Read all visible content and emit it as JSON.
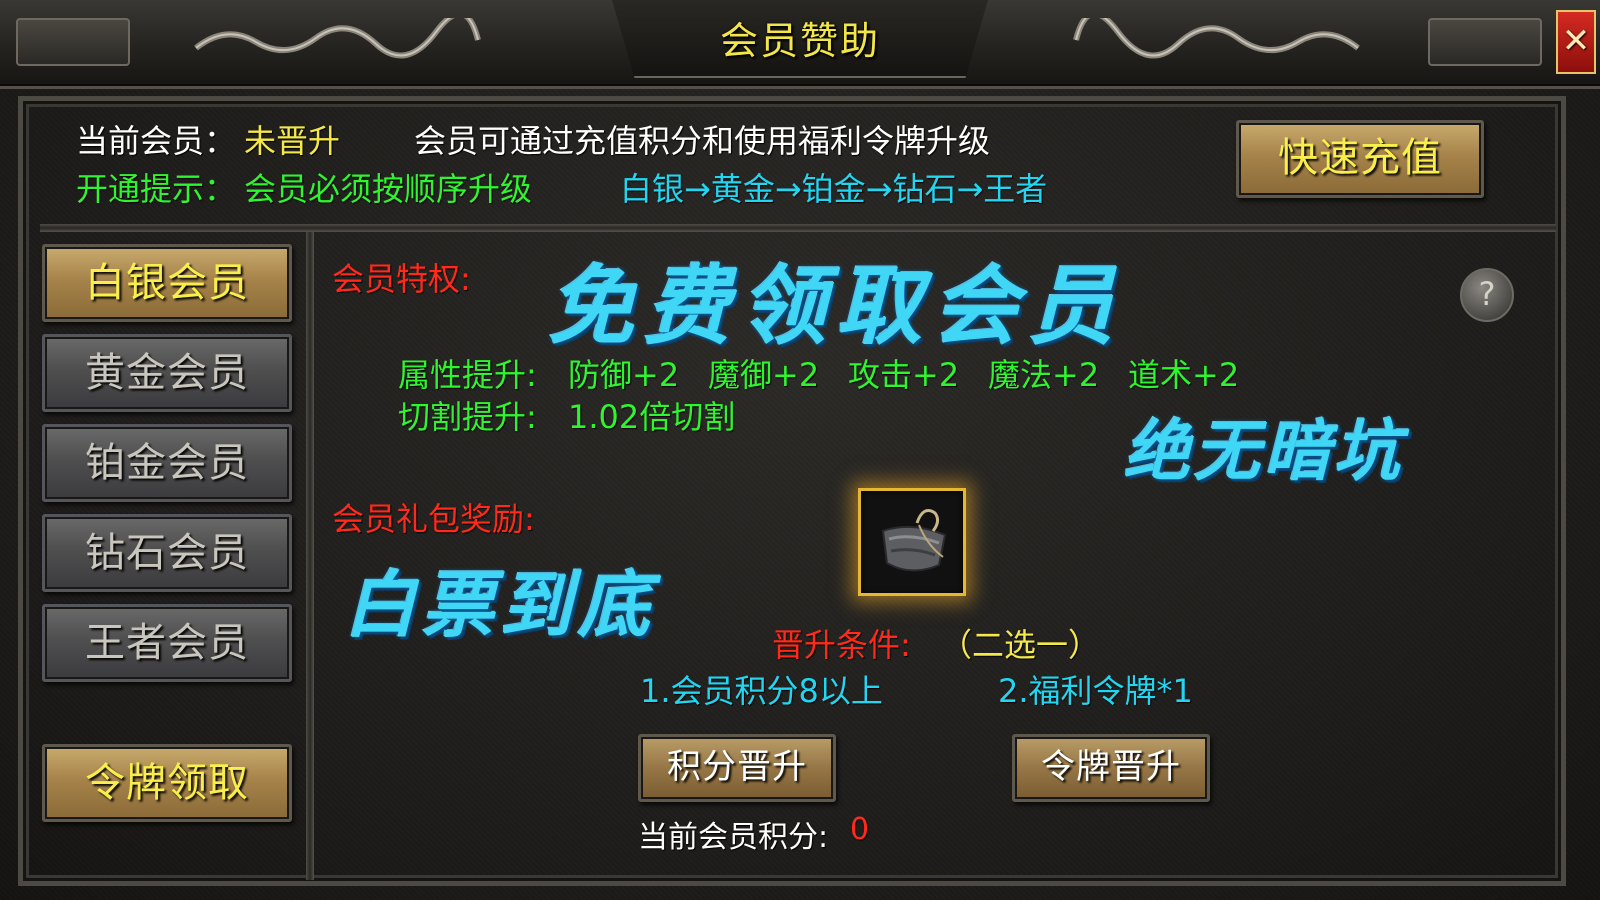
{
  "window": {
    "title": "会员赞助",
    "close_label": "✕"
  },
  "info": {
    "current_label": "当前会员：",
    "current_value": "未晋升",
    "upgrade_note": "会员可通过充值积分和使用福利令牌升级",
    "hint_label": "开通提示：",
    "hint_value": "会员必须按顺序升级",
    "tier_order": "白银→黄金→铂金→钻石→王者",
    "quick_recharge": "快速充值"
  },
  "sidebar": {
    "items": [
      {
        "label": "白银会员",
        "active": true
      },
      {
        "label": "黄金会员",
        "active": false
      },
      {
        "label": "铂金会员",
        "active": false
      },
      {
        "label": "钻石会员",
        "active": false
      },
      {
        "label": "王者会员",
        "active": false
      }
    ],
    "token_claim": "令牌领取"
  },
  "privilege": {
    "label": "会员特权:",
    "banner": "免费领取会员",
    "attr_label": "属性提升:",
    "attrs": [
      "防御+2",
      "魔御+2",
      "攻击+2",
      "魔法+2",
      "道术+2"
    ],
    "cut_label": "切割提升:",
    "cut_value": "1.02倍切割",
    "slogan": "绝无暗坑"
  },
  "gift": {
    "label": "会员礼包奖励:",
    "banner": "白票到底",
    "item_icon": "cloth-bag-icon"
  },
  "upgrade": {
    "cond_label": "晋升条件:",
    "cond_note": "（二选一）",
    "cond1": "1.会员积分8以上",
    "cond2": "2.福利令牌*1",
    "points_button": "积分晋升",
    "token_button": "令牌晋升",
    "points_label": "当前会员积分:",
    "points_value": "0"
  },
  "colors": {
    "title_yellow": "#f4e84b",
    "green": "#2ff52f",
    "cyan": "#22d6f2",
    "red": "#ff2a1a",
    "gold_button": "#a6834a"
  }
}
